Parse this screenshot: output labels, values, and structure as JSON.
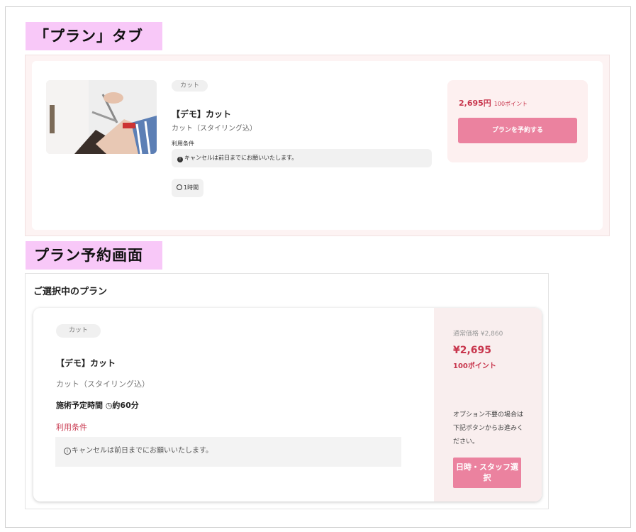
{
  "section_labels": {
    "plan_tab": "「プラン」タブ",
    "reservation_screen": "プラン予約画面"
  },
  "plan_tab": {
    "category_chip": "カット",
    "title": "【デモ】カット",
    "subtitle": "カット（スタイリング込）",
    "conditions_label": "利用条件",
    "notice": "キャンセルは前日までにお願いいたします。",
    "duration": "1時間",
    "price": "2,695円",
    "points": "100ポイント",
    "reserve_button": "プランを予約する"
  },
  "reservation": {
    "heading": "ご選択中のプラン",
    "category_chip": "カット",
    "title": "【デモ】カット",
    "subtitle": "カット（スタイリング込）",
    "duration": "施術予定時間 ◷約60分",
    "conditions_label": "利用条件",
    "notice": "キャンセルは前日までにお願いいたします。",
    "list_price": "通常価格 ¥2,860",
    "price": "¥2,695",
    "points": "100ポイント",
    "note": "オプション不要の場合は下記ボタンからお進みください。",
    "select_button": "日時・スタッフ選択"
  },
  "colors": {
    "accent": "#eb829f",
    "price_red": "#c8364d",
    "label_bg": "#f8c8f8",
    "side_bg": "#f9eeee"
  },
  "icons": [
    "info-icon",
    "clock-icon",
    "hair-photo"
  ]
}
